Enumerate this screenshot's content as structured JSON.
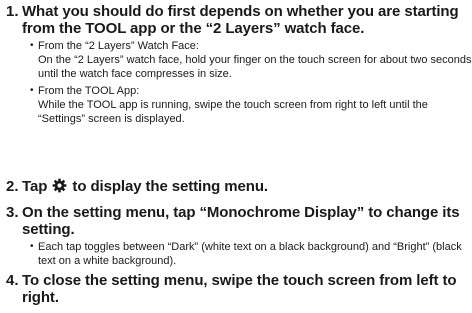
{
  "steps": [
    {
      "number": "1.",
      "heading": "What you should do first depends on whether you are starting from the TOOL app or the “2 Layers” watch face.",
      "bullets": [
        {
          "title": "From the “2 Layers” Watch Face:",
          "text": "On the “2 Layers” watch face, hold your finger on the touch screen for about two seconds until the watch face compresses in size."
        },
        {
          "title": "From the TOOL App:",
          "text": "While the TOOL app is running, swipe the touch screen from right to left until the “Settings” screen is displayed."
        }
      ]
    },
    {
      "number": "2.",
      "heading_before": "Tap",
      "icon": "gear-icon",
      "heading_after": "to display the setting menu."
    },
    {
      "number": "3.",
      "heading": "On the setting menu, tap “Monochrome Display” to change its setting.",
      "bullets": [
        {
          "text": "Each tap toggles between “Dark” (white text on a black background) and “Bright” (black text on a white background)."
        }
      ]
    },
    {
      "number": "4.",
      "heading": "To close the setting menu, swipe the touch screen from left to right."
    }
  ]
}
